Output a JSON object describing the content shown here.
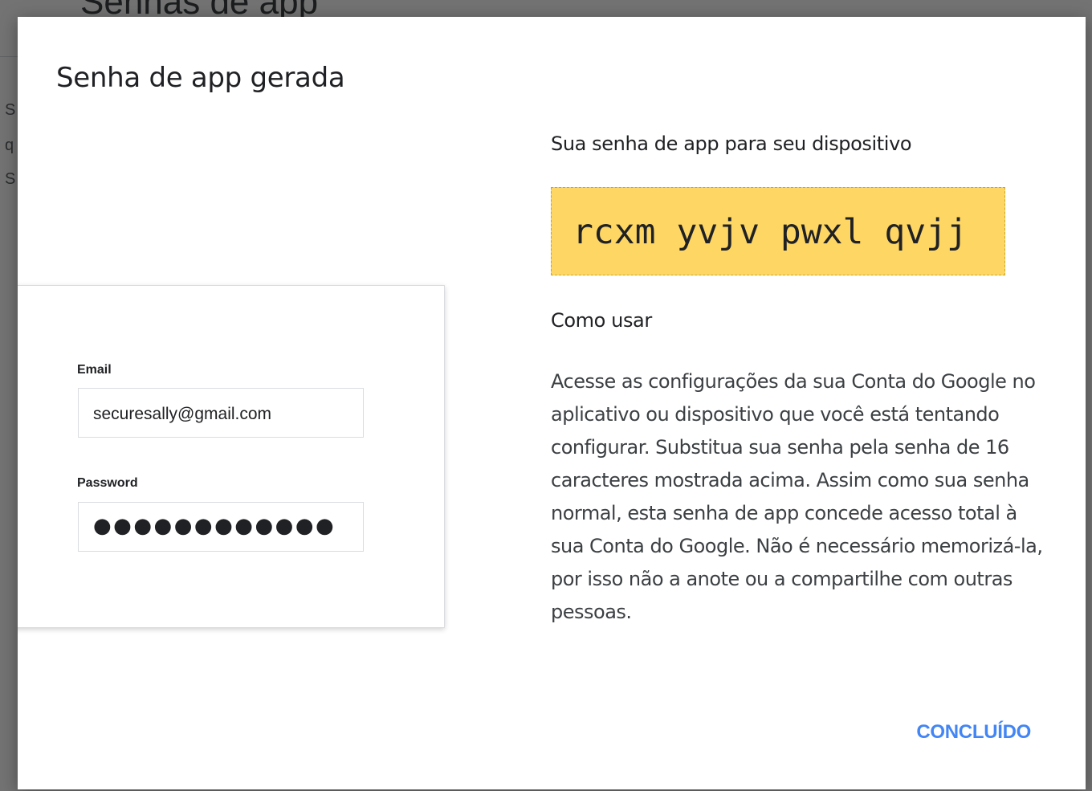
{
  "dialog": {
    "title": "Senha de app gerada",
    "illustration": {
      "email_label": "Email",
      "email_value": "securesally@gmail.com",
      "password_label": "Password",
      "password_value": "●●●●●●●●●●●●"
    },
    "subtitle": "Sua senha de app para seu dispositivo",
    "app_password": "rcxm yvjv pwxl qvjj",
    "how_to_heading": "Como usar",
    "how_to_text": "Acesse as configurações da sua Conta do Google no aplicativo ou dispositivo que você está tentando configurar. Substitua sua senha pela senha de 16 caracteres mostrada acima. Assim como sua senha normal, esta senha de app concede acesso total à sua Conta do Google. Não é necessário memorizá-la, por isso não a anote ou a compartilhe com outras pessoas.",
    "done_label": "CONCLUÍDO"
  },
  "colors": {
    "password_highlight": "#fdd663",
    "accent": "#4285f4"
  }
}
